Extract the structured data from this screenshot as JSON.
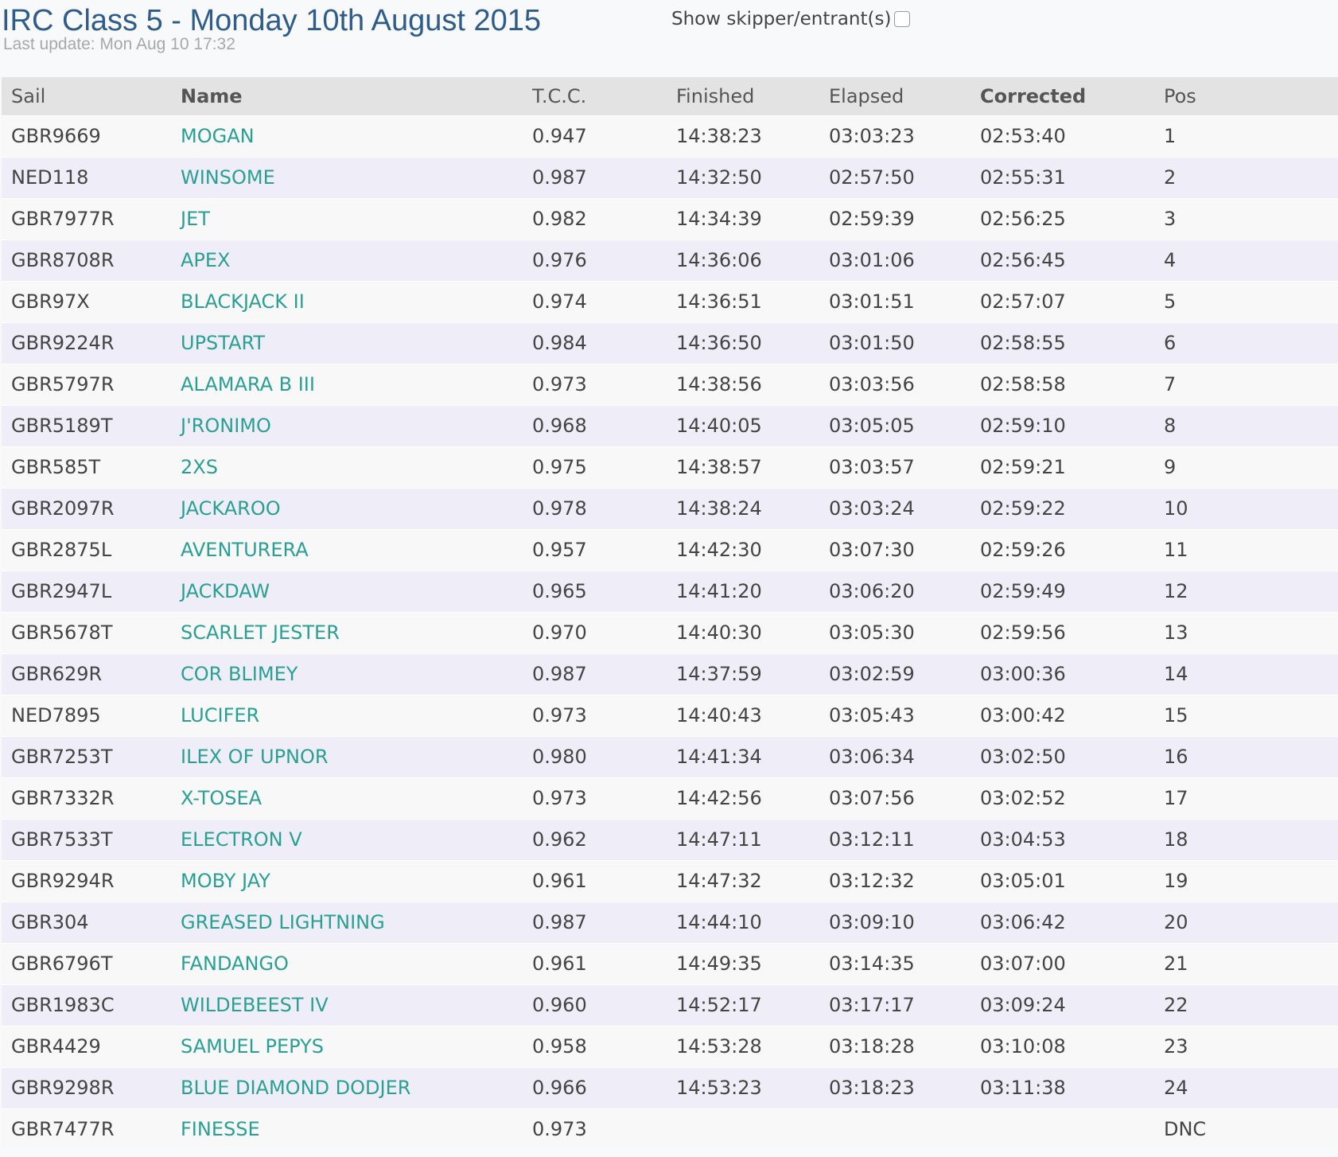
{
  "header": {
    "title": "IRC Class 5 - Monday 10th August 2015",
    "last_update": "Last update: Mon Aug 10 17:32",
    "skipper_toggle_label": "Show skipper/entrant(s)"
  },
  "table": {
    "columns": {
      "sail": "Sail",
      "name": "Name",
      "tcc": "T.C.C.",
      "finished": "Finished",
      "elapsed": "Elapsed",
      "corrected": "Corrected",
      "pos": "Pos"
    },
    "rows": [
      {
        "sail": "GBR9669",
        "name": "MOGAN",
        "tcc": "0.947",
        "finished": "14:38:23",
        "elapsed": "03:03:23",
        "corrected": "02:53:40",
        "pos": "1"
      },
      {
        "sail": "NED118",
        "name": "WINSOME",
        "tcc": "0.987",
        "finished": "14:32:50",
        "elapsed": "02:57:50",
        "corrected": "02:55:31",
        "pos": "2"
      },
      {
        "sail": "GBR7977R",
        "name": "JET",
        "tcc": "0.982",
        "finished": "14:34:39",
        "elapsed": "02:59:39",
        "corrected": "02:56:25",
        "pos": "3"
      },
      {
        "sail": "GBR8708R",
        "name": "APEX",
        "tcc": "0.976",
        "finished": "14:36:06",
        "elapsed": "03:01:06",
        "corrected": "02:56:45",
        "pos": "4"
      },
      {
        "sail": "GBR97X",
        "name": "BLACKJACK II",
        "tcc": "0.974",
        "finished": "14:36:51",
        "elapsed": "03:01:51",
        "corrected": "02:57:07",
        "pos": "5"
      },
      {
        "sail": "GBR9224R",
        "name": "UPSTART",
        "tcc": "0.984",
        "finished": "14:36:50",
        "elapsed": "03:01:50",
        "corrected": "02:58:55",
        "pos": "6"
      },
      {
        "sail": "GBR5797R",
        "name": "ALAMARA B III",
        "tcc": "0.973",
        "finished": "14:38:56",
        "elapsed": "03:03:56",
        "corrected": "02:58:58",
        "pos": "7"
      },
      {
        "sail": "GBR5189T",
        "name": "J'RONIMO",
        "tcc": "0.968",
        "finished": "14:40:05",
        "elapsed": "03:05:05",
        "corrected": "02:59:10",
        "pos": "8"
      },
      {
        "sail": "GBR585T",
        "name": "2XS",
        "tcc": "0.975",
        "finished": "14:38:57",
        "elapsed": "03:03:57",
        "corrected": "02:59:21",
        "pos": "9"
      },
      {
        "sail": "GBR2097R",
        "name": "JACKAROO",
        "tcc": "0.978",
        "finished": "14:38:24",
        "elapsed": "03:03:24",
        "corrected": "02:59:22",
        "pos": "10"
      },
      {
        "sail": "GBR2875L",
        "name": "AVENTURERA",
        "tcc": "0.957",
        "finished": "14:42:30",
        "elapsed": "03:07:30",
        "corrected": "02:59:26",
        "pos": "11"
      },
      {
        "sail": "GBR2947L",
        "name": "JACKDAW",
        "tcc": "0.965",
        "finished": "14:41:20",
        "elapsed": "03:06:20",
        "corrected": "02:59:49",
        "pos": "12"
      },
      {
        "sail": "GBR5678T",
        "name": "SCARLET JESTER",
        "tcc": "0.970",
        "finished": "14:40:30",
        "elapsed": "03:05:30",
        "corrected": "02:59:56",
        "pos": "13"
      },
      {
        "sail": "GBR629R",
        "name": "COR BLIMEY",
        "tcc": "0.987",
        "finished": "14:37:59",
        "elapsed": "03:02:59",
        "corrected": "03:00:36",
        "pos": "14"
      },
      {
        "sail": "NED7895",
        "name": "LUCIFER",
        "tcc": "0.973",
        "finished": "14:40:43",
        "elapsed": "03:05:43",
        "corrected": "03:00:42",
        "pos": "15"
      },
      {
        "sail": "GBR7253T",
        "name": "ILEX OF UPNOR",
        "tcc": "0.980",
        "finished": "14:41:34",
        "elapsed": "03:06:34",
        "corrected": "03:02:50",
        "pos": "16"
      },
      {
        "sail": "GBR7332R",
        "name": "X-TOSEA",
        "tcc": "0.973",
        "finished": "14:42:56",
        "elapsed": "03:07:56",
        "corrected": "03:02:52",
        "pos": "17"
      },
      {
        "sail": "GBR7533T",
        "name": "ELECTRON V",
        "tcc": "0.962",
        "finished": "14:47:11",
        "elapsed": "03:12:11",
        "corrected": "03:04:53",
        "pos": "18"
      },
      {
        "sail": "GBR9294R",
        "name": "MOBY JAY",
        "tcc": "0.961",
        "finished": "14:47:32",
        "elapsed": "03:12:32",
        "corrected": "03:05:01",
        "pos": "19"
      },
      {
        "sail": "GBR304",
        "name": "GREASED LIGHTNING",
        "tcc": "0.987",
        "finished": "14:44:10",
        "elapsed": "03:09:10",
        "corrected": "03:06:42",
        "pos": "20"
      },
      {
        "sail": "GBR6796T",
        "name": "FANDANGO",
        "tcc": "0.961",
        "finished": "14:49:35",
        "elapsed": "03:14:35",
        "corrected": "03:07:00",
        "pos": "21"
      },
      {
        "sail": "GBR1983C",
        "name": "WILDEBEEST IV",
        "tcc": "0.960",
        "finished": "14:52:17",
        "elapsed": "03:17:17",
        "corrected": "03:09:24",
        "pos": "22"
      },
      {
        "sail": "GBR4429",
        "name": "SAMUEL PEPYS",
        "tcc": "0.958",
        "finished": "14:53:28",
        "elapsed": "03:18:28",
        "corrected": "03:10:08",
        "pos": "23"
      },
      {
        "sail": "GBR9298R",
        "name": "BLUE DIAMOND DODJER",
        "tcc": "0.966",
        "finished": "14:53:23",
        "elapsed": "03:18:23",
        "corrected": "03:11:38",
        "pos": "24"
      },
      {
        "sail": "GBR7477R",
        "name": "FINESSE",
        "tcc": "0.973",
        "finished": "",
        "elapsed": "",
        "corrected": "",
        "pos": "DNC"
      }
    ]
  }
}
